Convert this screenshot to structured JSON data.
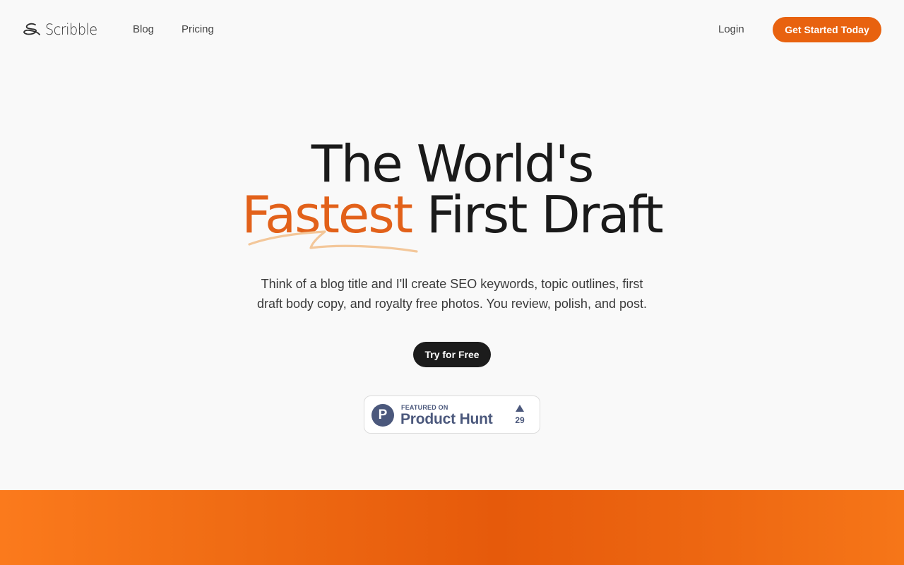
{
  "nav": {
    "logo_text": "Scribble",
    "links": [
      {
        "label": "Blog"
      },
      {
        "label": "Pricing"
      }
    ],
    "login_label": "Login",
    "cta_label": "Get Started Today"
  },
  "hero": {
    "title_line1": "The World's",
    "title_accent": "Fastest",
    "title_rest": "First Draft",
    "subtitle_line1": "Think of a blog title and I'll create SEO keywords, topic outlines, first",
    "subtitle_line2": "draft body copy, and royalty free photos. You review, polish, and post.",
    "try_label": "Try for Free"
  },
  "product_hunt": {
    "featured_label": "FEATURED ON",
    "name": "Product Hunt",
    "logo_letter": "P",
    "upvotes": "29"
  },
  "colors": {
    "accent": "#e2611a",
    "cta": "#e8620f",
    "dark_button": "#1c1c1c",
    "product_hunt": "#4b587c",
    "band": "#e65a0b"
  },
  "icons": {
    "logo": "scribble-logo-icon",
    "upvote": "upvote-triangle-icon",
    "underline": "squiggle-underline"
  }
}
